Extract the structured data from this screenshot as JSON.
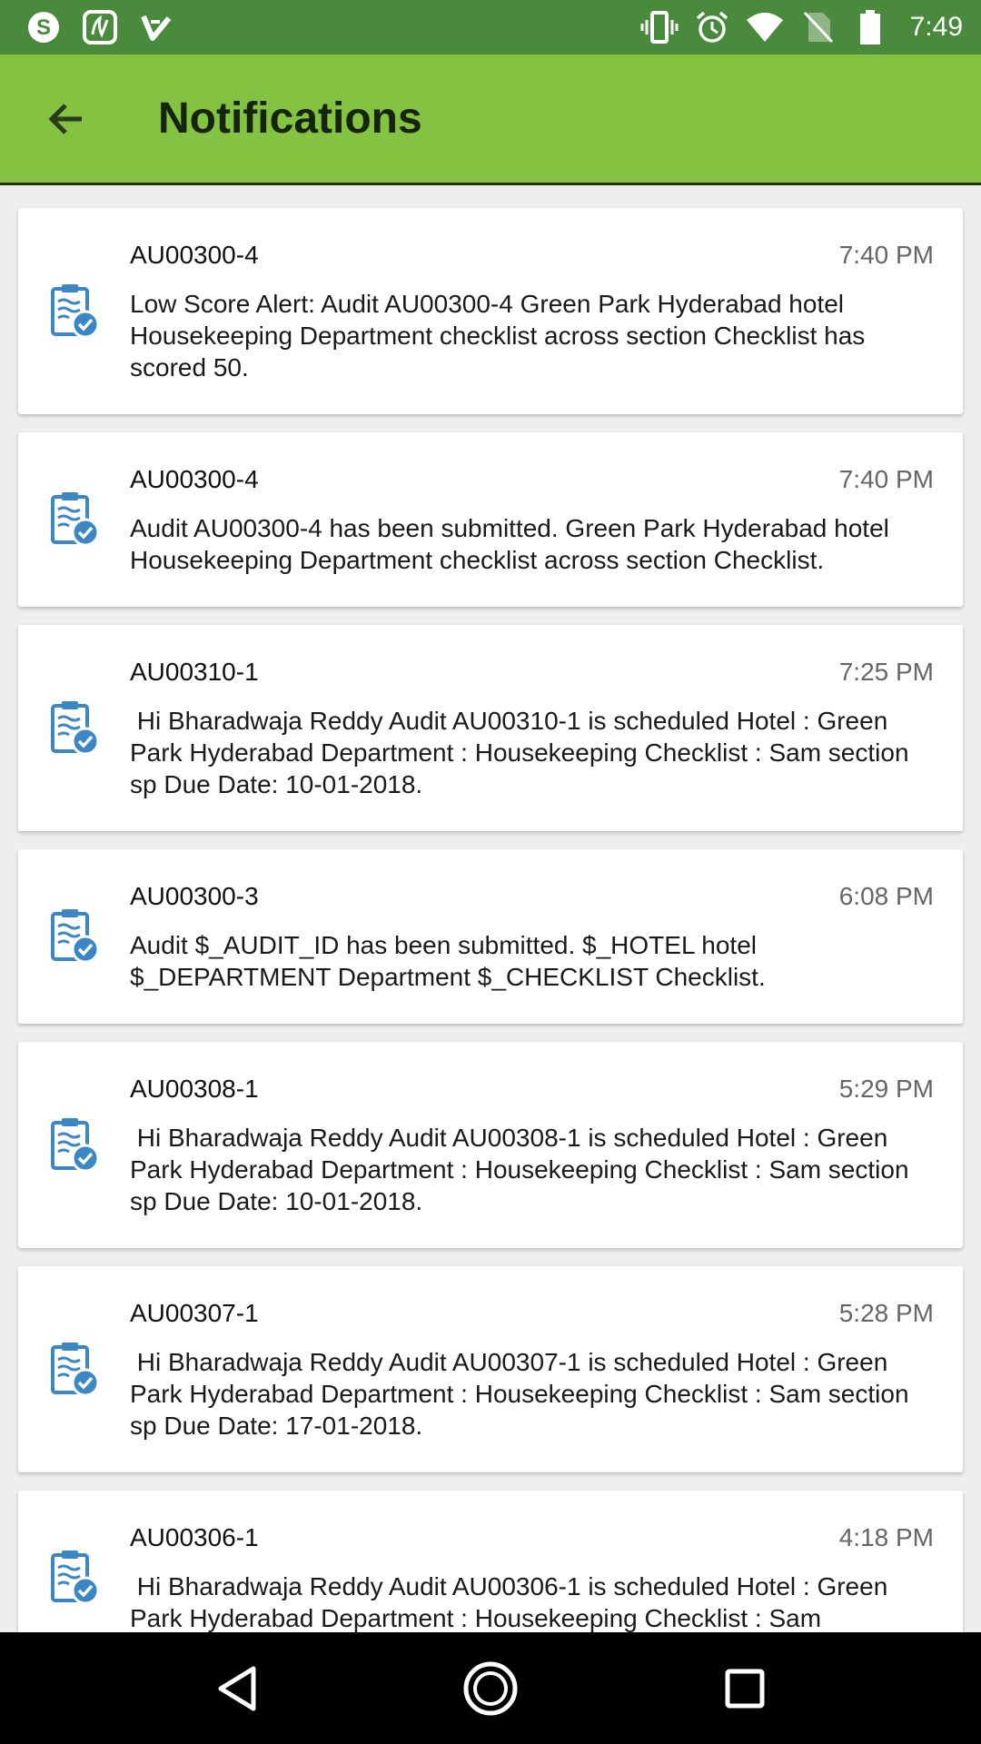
{
  "status_bar": {
    "left_icons": [
      "skype-icon",
      "saavn-icon",
      "tick-app-icon"
    ],
    "right_icons": [
      "vibrate-icon",
      "alarm-icon",
      "wifi-icon",
      "no-sim-icon",
      "battery-icon"
    ],
    "time": "7:49"
  },
  "app_bar": {
    "title": "Notifications",
    "back_icon": "arrow-back-icon",
    "color": "#83c341"
  },
  "notifications": [
    {
      "id": "AU00300-4",
      "time": "7:40 PM",
      "message": "Low Score Alert: Audit AU00300-4 Green Park Hyderabad hotel Housekeeping Department checklist across section Checklist has scored 50.",
      "icon": "checklist-icon"
    },
    {
      "id": "AU00300-4",
      "time": "7:40 PM",
      "message": "Audit AU00300-4 has been submitted. Green Park Hyderabad hotel Housekeeping Department checklist across section Checklist.",
      "icon": "checklist-icon"
    },
    {
      "id": "AU00310-1",
      "time": "7:25 PM",
      "message": " Hi Bharadwaja Reddy Audit AU00310-1 is scheduled Hotel : Green Park Hyderabad Department : Housekeeping Checklist : Sam section sp Due Date: 10-01-2018.",
      "icon": "checklist-icon"
    },
    {
      "id": "AU00300-3",
      "time": "6:08 PM",
      "message": "Audit $_AUDIT_ID has been submitted. $_HOTEL hotel $_DEPARTMENT Department $_CHECKLIST Checklist.",
      "icon": "checklist-icon"
    },
    {
      "id": "AU00308-1",
      "time": "5:29 PM",
      "message": " Hi Bharadwaja Reddy Audit AU00308-1 is scheduled Hotel : Green Park Hyderabad Department : Housekeeping Checklist : Sam section sp Due Date: 10-01-2018.",
      "icon": "checklist-icon"
    },
    {
      "id": "AU00307-1",
      "time": "5:28 PM",
      "message": " Hi Bharadwaja Reddy Audit AU00307-1 is scheduled Hotel : Green Park Hyderabad Department : Housekeeping Checklist : Sam section sp Due Date: 17-01-2018.",
      "icon": "checklist-icon"
    },
    {
      "id": "AU00306-1",
      "time": "4:18 PM",
      "message": " Hi Bharadwaja Reddy Audit AU00306-1 is scheduled Hotel : Green Park Hyderabad Department : Housekeeping Checklist : Sam",
      "icon": "checklist-icon"
    }
  ],
  "nav_bar": {
    "buttons": [
      "back-triangle-icon",
      "home-circle-icon",
      "recents-square-icon"
    ]
  }
}
